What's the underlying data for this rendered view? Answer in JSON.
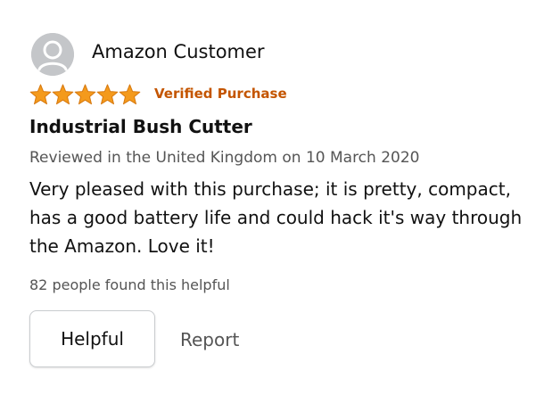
{
  "review": {
    "reviewer_name": "Amazon Customer",
    "avatar_icon": "default-profile-icon",
    "rating": {
      "value": 5,
      "max": 5,
      "star_color": "#f49a1c"
    },
    "verified_label": "Verified Purchase",
    "verified_color": "#c45500",
    "title": "Industrial Bush Cutter",
    "date_text": "Reviewed in the United Kingdom on 10 March 2020",
    "body": "Very pleased with this purchase; it is pretty, compact, has a good battery life and could hack it's way through the Amazon. Love it!",
    "helpful_count_text": "82 people found this helpful"
  },
  "actions": {
    "helpful_label": "Helpful",
    "report_label": "Report"
  }
}
